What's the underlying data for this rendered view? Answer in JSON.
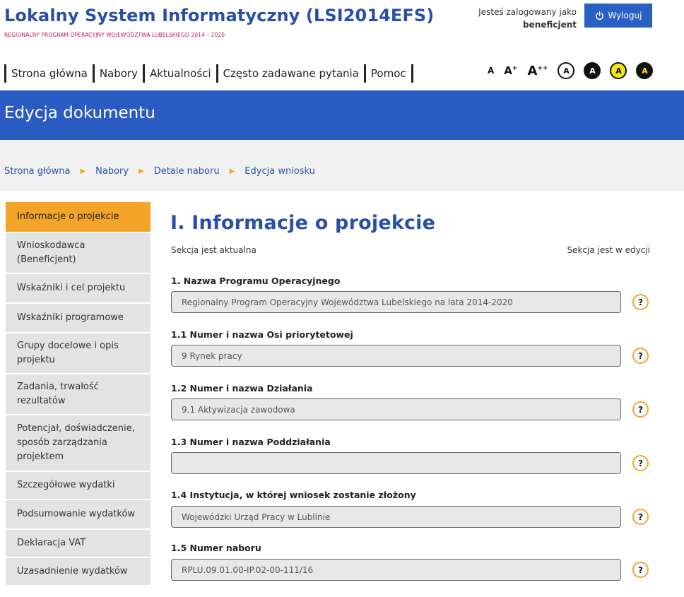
{
  "header": {
    "title": "Lokalny System Informatyczny (LSI2014EFS)",
    "subtitle": "REGIONALNY PROGRAM OPERACYJNY WOJEWÓDZTWA LUBELSKIEGO 2014 – 2020",
    "logged_as": "Jesteś zalogowany jako",
    "role": "beneficjent",
    "logout_label": "Wyloguj"
  },
  "nav": {
    "items": [
      {
        "label": "Strona główna"
      },
      {
        "label": "Nabory"
      },
      {
        "label": "Aktualności"
      },
      {
        "label": "Często zadawane pytania"
      },
      {
        "label": "Pomoc"
      }
    ]
  },
  "accessibility": {
    "font_small": "A",
    "font_medium": "A",
    "font_medium_sup": "+",
    "font_large": "A",
    "font_large_sup": "++",
    "contrast": [
      "A",
      "A",
      "A",
      "A"
    ]
  },
  "page": {
    "title": "Edycja dokumentu"
  },
  "breadcrumb": {
    "items": [
      "Strona główna",
      "Nabory",
      "Detale naboru",
      "Edycja wniosku"
    ],
    "separator": "▶"
  },
  "sidebar": {
    "items": [
      {
        "label": "Informacje o projekcie",
        "active": true
      },
      {
        "label": "Wnioskodawca (Beneficjent)"
      },
      {
        "label": "Wskaźniki i cel projektu"
      },
      {
        "label": "Wskaźniki programowe"
      },
      {
        "label": "Grupy docelowe i opis projektu"
      },
      {
        "label": "Zadania, trwałość rezultatów"
      },
      {
        "label": "Potencjał, doświadczenie, sposób zarządzania projektem"
      },
      {
        "label": "Szczegółowe wydatki"
      },
      {
        "label": "Podsumowanie wydatków"
      },
      {
        "label": "Deklaracja VAT"
      },
      {
        "label": "Uzasadnienie wydatków"
      }
    ]
  },
  "section": {
    "title": "I. Informacje o projekcie",
    "status_left": "Sekcja jest aktualna",
    "status_right": "Sekcja jest w edycji",
    "help_symbol": "?",
    "fields": [
      {
        "label": "1. Nazwa Programu Operacyjnego",
        "value": "Regionalny Program Operacyjny Województwa Lubelskiego na lata 2014-2020"
      },
      {
        "label": "1.1 Numer i nazwa Osi priorytetowej",
        "value": "9 Rynek pracy"
      },
      {
        "label": "1.2 Numer i nazwa Działania",
        "value": "9.1 Aktywizacja zawodowa"
      },
      {
        "label": "1.3 Numer i nazwa Poddziałania",
        "value": ""
      },
      {
        "label": "1.4 Instytucja, w której wniosek zostanie złożony",
        "value": "Wojewódzki Urząd Pracy w Lublinie"
      },
      {
        "label": "1.5 Numer naboru",
        "value": "RPLU.09.01.00-IP.02-00-111/16"
      }
    ]
  },
  "colors": {
    "brand_blue": "#2a4fa8",
    "band_blue": "#2a5bc0",
    "accent_orange": "#f4a426",
    "subtitle_magenta": "#c2185b"
  }
}
